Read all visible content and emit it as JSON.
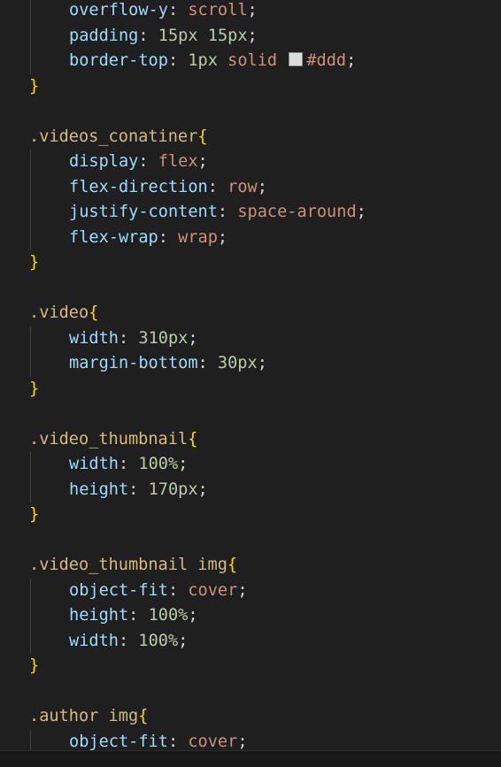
{
  "colors": {
    "background": "#1f1f1f",
    "selector": "#d7ba7d",
    "brace": "#ffd700",
    "property": "#9cdcfe",
    "number": "#b5cea8",
    "string_value": "#ce9178",
    "punctuation": "#d4d4d4",
    "swatch": "#dddddd"
  },
  "code": {
    "l1": {
      "prop": "overflow-y",
      "colon": ": ",
      "val": "scroll",
      "semi": ";"
    },
    "l2": {
      "prop": "padding",
      "colon": ": ",
      "num1": "15px",
      "sp": " ",
      "num2": "15px",
      "semi": ";"
    },
    "l3": {
      "prop": "border-top",
      "colon": ": ",
      "num": "1px",
      "sp": " ",
      "val": "solid",
      "sp2": " ",
      "color": "#ddd",
      "semi": ";"
    },
    "l4": {
      "brace": "}"
    },
    "l6": {
      "selector": ".videos_conatiner",
      "brace": "{"
    },
    "l7": {
      "prop": "display",
      "colon": ": ",
      "val": "flex",
      "semi": ";"
    },
    "l8": {
      "prop": "flex-direction",
      "colon": ": ",
      "val": "row",
      "semi": ";"
    },
    "l9": {
      "prop": "justify-content",
      "colon": ": ",
      "val": "space-around",
      "semi": ";"
    },
    "l10": {
      "prop": "flex-wrap",
      "colon": ": ",
      "val": "wrap",
      "semi": ";"
    },
    "l11": {
      "brace": "}"
    },
    "l13": {
      "selector": ".video",
      "brace": "{"
    },
    "l14": {
      "prop": "width",
      "colon": ": ",
      "num": "310px",
      "semi": ";"
    },
    "l15": {
      "prop": "margin-bottom",
      "colon": ": ",
      "num": "30px",
      "semi": ";"
    },
    "l16": {
      "brace": "}"
    },
    "l18": {
      "selector": ".video_thumbnail",
      "brace": "{"
    },
    "l19": {
      "prop": "width",
      "colon": ": ",
      "num": "100%",
      "semi": ";"
    },
    "l20": {
      "prop": "height",
      "colon": ": ",
      "num": "170px",
      "semi": ";"
    },
    "l21": {
      "brace": "}"
    },
    "l23": {
      "selector": ".video_thumbnail img",
      "brace": "{"
    },
    "l24": {
      "prop": "object-fit",
      "colon": ": ",
      "val": "cover",
      "semi": ";"
    },
    "l25": {
      "prop": "height",
      "colon": ": ",
      "num": "100%",
      "semi": ";"
    },
    "l26": {
      "prop": "width",
      "colon": ": ",
      "num": "100%",
      "semi": ";"
    },
    "l27": {
      "brace": "}"
    },
    "l29": {
      "selector": ".author img",
      "brace": "{"
    },
    "l30": {
      "prop": "object-fit",
      "colon": ": ",
      "val": "cover",
      "semi": ";"
    }
  }
}
